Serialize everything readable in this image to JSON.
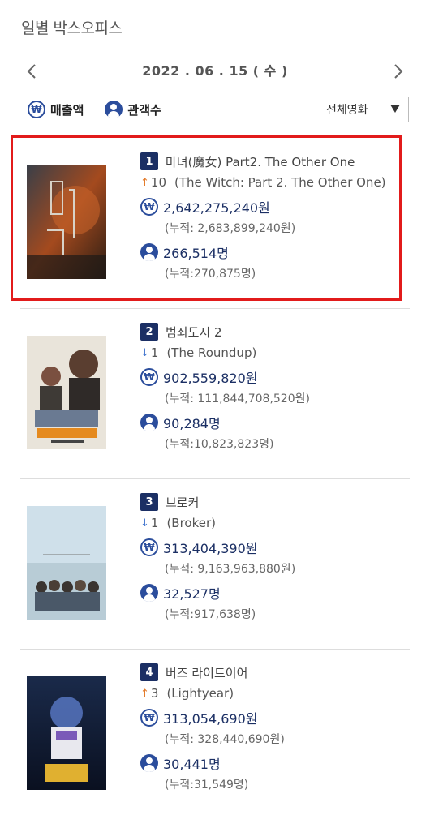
{
  "page": {
    "title": "일별 박스오피스"
  },
  "date_nav": {
    "date": "2022 . 06 . 15 ( 수 )"
  },
  "legend": {
    "sales_label": "매출액",
    "audience_label": "관객수",
    "won_symbol": "₩"
  },
  "filter": {
    "selected": "전체영화"
  },
  "icons": {
    "prev": "chevron-left-icon",
    "next": "chevron-right-icon",
    "won": "won-icon",
    "person": "person-icon",
    "dropdown": "caret-down-icon"
  },
  "colors": {
    "badge": "#1b2f64",
    "amount": "#1b2f64",
    "up": "#e37a2a",
    "down": "#4a7bd0",
    "highlight": "#e21b1b"
  },
  "movies": [
    {
      "rank": "1",
      "title": "마녀(魔女) Part2. The Other One",
      "change_dir": "up",
      "change_arrow": "↑",
      "change": "10",
      "orig_title": "(The Witch: Part 2. The Other One)",
      "sales": "2,642,275,240원",
      "sales_cum": "(누적: 2,683,899,240원)",
      "audience": "266,514명",
      "audience_cum": "(누적:270,875명)"
    },
    {
      "rank": "2",
      "title": "범죄도시 2",
      "change_dir": "down",
      "change_arrow": "↓",
      "change": "1",
      "orig_title": "(The Roundup)",
      "sales": "902,559,820원",
      "sales_cum": "(누적: 111,844,708,520원)",
      "audience": "90,284명",
      "audience_cum": "(누적:10,823,823명)"
    },
    {
      "rank": "3",
      "title": "브로커",
      "change_dir": "down",
      "change_arrow": "↓",
      "change": "1",
      "orig_title": "(Broker)",
      "sales": "313,404,390원",
      "sales_cum": "(누적: 9,163,963,880원)",
      "audience": "32,527명",
      "audience_cum": "(누적:917,638명)"
    },
    {
      "rank": "4",
      "title": "버즈 라이트이어",
      "change_dir": "up",
      "change_arrow": "↑",
      "change": "3",
      "orig_title": "(Lightyear)",
      "sales": "313,054,690원",
      "sales_cum": "(누적: 328,440,690원)",
      "audience": "30,441명",
      "audience_cum": "(누적:31,549명)"
    }
  ]
}
